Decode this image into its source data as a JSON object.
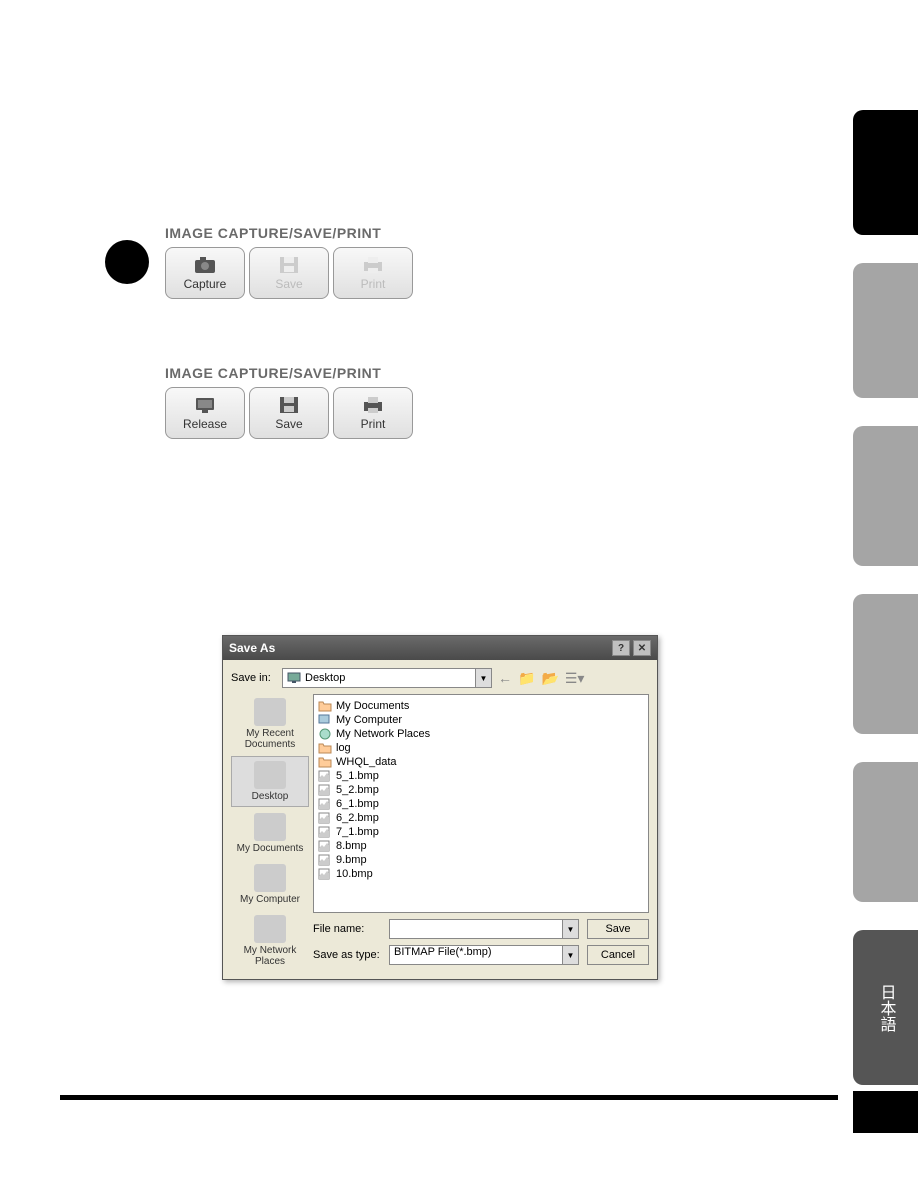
{
  "panel1": {
    "title": "IMAGE CAPTURE/SAVE/PRINT",
    "buttons": {
      "capture": "Capture",
      "save": "Save",
      "print": "Print"
    }
  },
  "panel2": {
    "title": "IMAGE CAPTURE/SAVE/PRINT",
    "buttons": {
      "release": "Release",
      "save": "Save",
      "print": "Print"
    }
  },
  "dialog": {
    "title": "Save As",
    "savein_label": "Save in:",
    "savein_value": "Desktop",
    "places": {
      "recent": "My Recent Documents",
      "desktop": "Desktop",
      "mydocs": "My Documents",
      "computer": "My Computer",
      "network": "My Network Places"
    },
    "files": [
      "My Documents",
      "My Computer",
      "My Network Places",
      "log",
      "WHQL_data",
      "5_1.bmp",
      "5_2.bmp",
      "6_1.bmp",
      "6_2.bmp",
      "7_1.bmp",
      "8.bmp",
      "9.bmp",
      "10.bmp"
    ],
    "filename_label": "File name:",
    "filename_value": "",
    "saveas_label": "Save as type:",
    "saveas_value": "BITMAP File(*.bmp)",
    "save_btn": "Save",
    "cancel_btn": "Cancel"
  },
  "tab_lang": "日本語"
}
